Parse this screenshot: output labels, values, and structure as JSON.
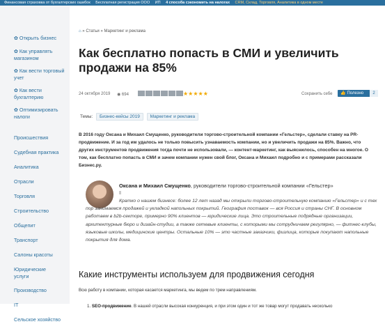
{
  "topbar": {
    "items": [
      {
        "text": "Финансовая страховка от бухгалтерских ошибок",
        "bold": false
      },
      {
        "text": "Бесплатная регистрация ООО",
        "bold": false
      },
      {
        "text": "ИП",
        "bold": false
      },
      {
        "text": "4 способа сэкономить на налогах",
        "bold": true
      },
      {
        "text": "CRM, Склад, Торговля, Аналитика в одном месте",
        "bold": false
      }
    ]
  },
  "sidebar": {
    "actions": [
      {
        "label": "Открыть бизнес"
      },
      {
        "label": "Как управлять магазином"
      },
      {
        "label": "Как вести торговый учет"
      },
      {
        "label": "Как вести бухгалтерию"
      },
      {
        "label": "Оптимизировать налоги"
      }
    ],
    "categories": [
      "Происшествия",
      "Судебная практика",
      "Аналитика",
      "Отрасли",
      "Торговля",
      "Строительство",
      "Общепит",
      "Транспорт",
      "Салоны красоты",
      "Юридические услуги",
      "Производство",
      "IT",
      "Сельское хозяйство"
    ]
  },
  "breadcrumb": {
    "sep": "»",
    "items": [
      "Статьи",
      "Маркетинг и реклама"
    ]
  },
  "article": {
    "title": "Как бесплатно попасть в СМИ и увеличить продажи на 85%",
    "date": "24 октября 2019",
    "views": "694",
    "save_label": "Сохранить себе",
    "useful_label": "Полезно",
    "useful_count": "2",
    "topics_label": "Темы:",
    "topics": [
      "Бизнес-кейсы 2019",
      "Маркетинг и реклама"
    ],
    "lead": "В 2016 году Оксана и Михаил Смущенко, руководители торгово-строительной компании «Гельстер», сделали ставку на PR-продвижение. И за год им удалось не только повысить узнаваемость компании, но и увеличить продажи на 85%. Важно, что других инструментов продвижения тогда почти не использовали, — контент-маркетинг, как выяснилось, способен на многое. О том, как бесплатно попасть в СМИ и зачем компании нужен свой блог, Оксана и Михаил подробно и с примерами рассказали Бизнес.ру.",
    "quote_author": "Оксана и Михаил Смущенко",
    "quote_role": ", руководители торгово-строительной компании «Гельстер»",
    "quote_text": "Кратко о нашем бизнесе: более 12 лет назад мы открыли торгово-строительную компанию «Гельстер» и с тех пор занимаемся продажей и укладкой напольных покрытий. География поставок — вся Россия и страны СНГ. В основном работаем в b2b-секторе, примерно 90% клиентов — юридические лица. Это строительные подрядные организации, архитектурные бюро и дизайн-студии, а также сетевые клиенты, с которыми мы сотрудничаем регулярно, — фитнес-клубы, языковые школы, медицинские центры. Остальные 10% — это частные заказчики, физлица, которые покупают напольные покрытия для дома.",
    "h2": "Какие инструменты используем для продвижения сегодня",
    "p2": "Всю работу в компании, которая касается маркетинга, мы ведем по трем направлениям.",
    "p3_num": "1.",
    "p3_bold": "SEO-продвижение",
    "p3_rest": ". В нашей отрасли высокая конкуренция, и при этом один и тот же товар могут продавать несколько"
  },
  "colors": {
    "accent": "#2a6f9e",
    "star": "#f2a900"
  }
}
